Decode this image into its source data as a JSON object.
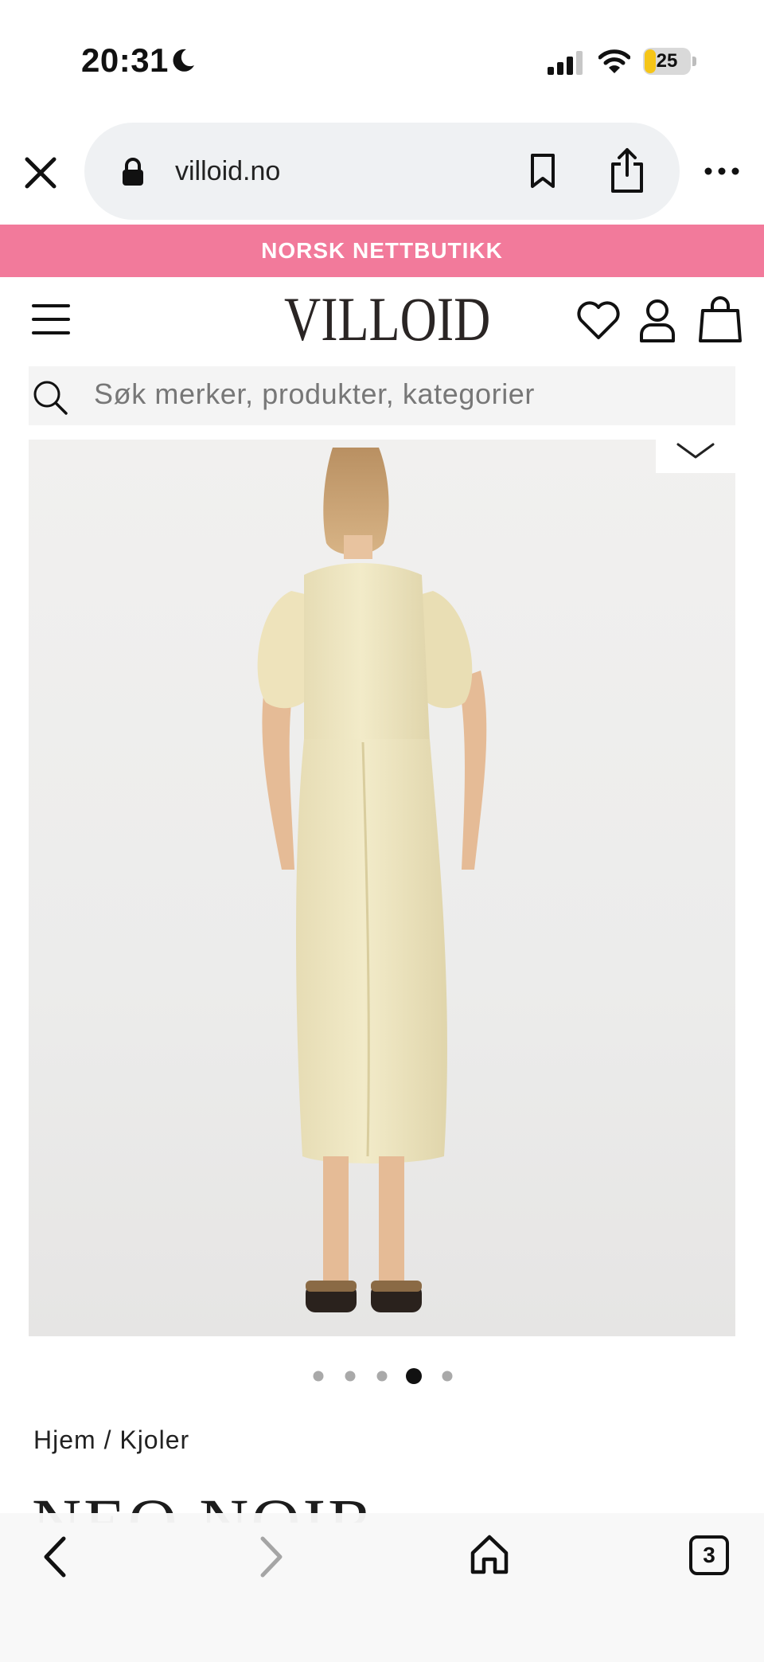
{
  "status_bar": {
    "time": "20:31",
    "battery_level": "25",
    "battery_fraction": 0.25,
    "battery_color": "#f5c518"
  },
  "browser": {
    "url": "villoid.no",
    "open_tabs": "3"
  },
  "announcement": {
    "text": "NORSK NETTBUTIKK",
    "background": "#f27a9b"
  },
  "header": {
    "logo": "VILLOID"
  },
  "search": {
    "placeholder": "Søk merker, produkter, kategorier"
  },
  "gallery": {
    "image_alt": "Back view of a woman wearing a cream satin midi dress with puff sleeves",
    "slide_count": 5,
    "active_slide": 4
  },
  "breadcrumb": "Hjem / Kjoler",
  "product": {
    "brand": "NEO NOIR"
  },
  "icons": [
    "close-icon",
    "lock-icon",
    "bookmark-icon",
    "share-icon",
    "more-icon",
    "menu-icon",
    "heart-icon",
    "user-icon",
    "bag-icon",
    "search-icon",
    "chevron-down-icon",
    "back-icon",
    "forward-icon",
    "home-icon"
  ]
}
